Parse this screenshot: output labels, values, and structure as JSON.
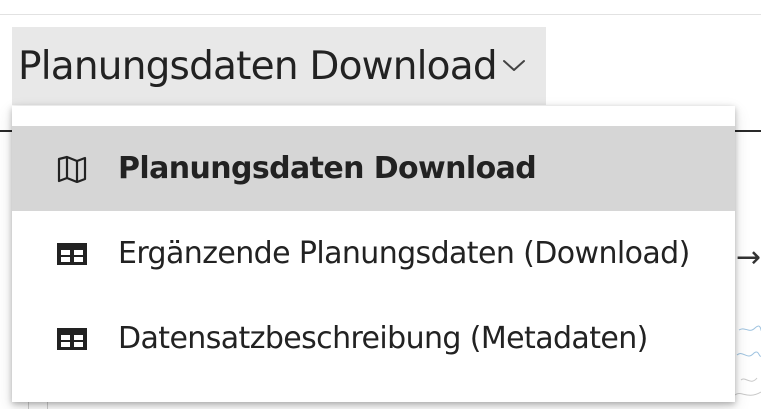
{
  "trigger": {
    "label": "Planungsdaten Download",
    "icon": "chevron-down-icon"
  },
  "menu": {
    "items": [
      {
        "label": "Planungsdaten Download",
        "icon": "map-icon",
        "selected": true
      },
      {
        "label": "Ergänzende Planungsdaten (Download)",
        "icon": "table-icon",
        "selected": false
      },
      {
        "label": "Datensatzbeschreibung (Metadaten)",
        "icon": "table-icon",
        "selected": false
      }
    ]
  },
  "background": {
    "arrow": "→"
  },
  "colors": {
    "selected_bg": "#d6d6d6",
    "trigger_bg": "#e8e8e8",
    "text": "#222222"
  }
}
